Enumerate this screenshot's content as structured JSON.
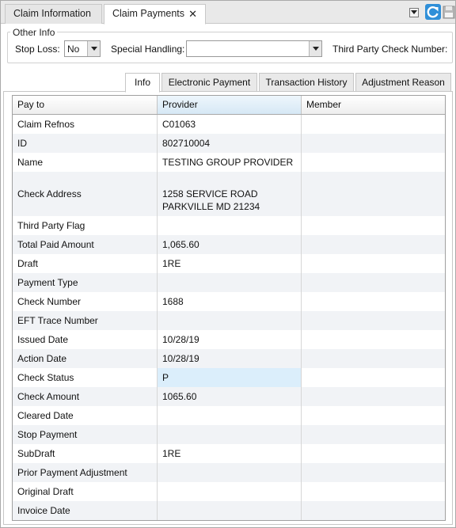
{
  "doc_tabs": [
    {
      "label": "Claim Information"
    },
    {
      "label": "Claim Payments",
      "close": "✕"
    }
  ],
  "other_info": {
    "title": "Other Info",
    "stop_loss_label": "Stop Loss:",
    "stop_loss_value": "No",
    "special_handling_label": "Special Handling:",
    "special_handling_value": "",
    "third_party_label": "Third Party Check Number:"
  },
  "sub_tabs": [
    {
      "label": "Info",
      "active": true
    },
    {
      "label": "Electronic Payment"
    },
    {
      "label": "Transaction History"
    },
    {
      "label": "Adjustment Reason"
    }
  ],
  "grid": {
    "columns": [
      "Pay to",
      "Provider",
      "Member"
    ],
    "rows": [
      {
        "field": "Claim Refnos",
        "provider": "C01063",
        "member": ""
      },
      {
        "field": "ID",
        "provider": "802710004",
        "member": ""
      },
      {
        "field": "Name",
        "provider": "TESTING GROUP PROVIDER",
        "member": ""
      },
      {
        "field": "Check Address",
        "provider": "1258 SERVICE ROAD\nPARKVILLE MD 21234",
        "member": ""
      },
      {
        "field": "Third Party Flag",
        "provider": "",
        "member": ""
      },
      {
        "field": "Total Paid Amount",
        "provider": "1,065.60",
        "member": ""
      },
      {
        "field": "Draft",
        "provider": "1RE",
        "member": ""
      },
      {
        "field": "Payment Type",
        "provider": "",
        "member": ""
      },
      {
        "field": "Check Number",
        "provider": "1688",
        "member": ""
      },
      {
        "field": "EFT Trace Number",
        "provider": "",
        "member": ""
      },
      {
        "field": "Issued Date",
        "provider": "10/28/19",
        "member": ""
      },
      {
        "field": "Action Date",
        "provider": "10/28/19",
        "member": ""
      },
      {
        "field": "Check Status",
        "provider": "P",
        "member": ""
      },
      {
        "field": "Check Amount",
        "provider": "1065.60",
        "member": ""
      },
      {
        "field": "Cleared Date",
        "provider": "",
        "member": ""
      },
      {
        "field": "Stop Payment",
        "provider": "",
        "member": ""
      },
      {
        "field": "SubDraft",
        "provider": "1RE",
        "member": ""
      },
      {
        "field": "Prior Payment Adjustment",
        "provider": "",
        "member": ""
      },
      {
        "field": "Original Draft",
        "provider": "",
        "member": ""
      },
      {
        "field": "Invoice Date",
        "provider": "",
        "member": ""
      }
    ]
  },
  "colors": {
    "selected_cell": "#dbeefb",
    "alt_row": "#f1f3f6",
    "refresh_icon": "#2f8fd8"
  },
  "icons": [
    "dropdown-icon",
    "refresh-icon",
    "save-icon",
    "close-icon",
    "chevron-down-icon"
  ]
}
